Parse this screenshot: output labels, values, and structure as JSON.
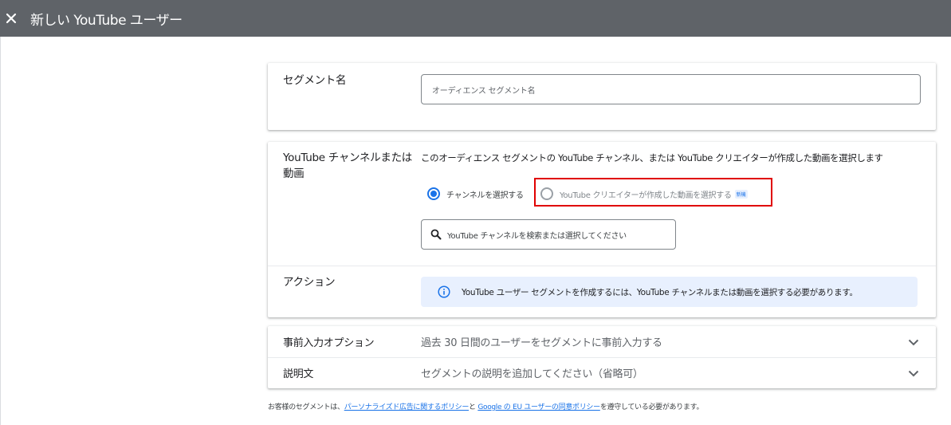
{
  "header": {
    "close_icon": "close-icon",
    "title": "新しい YouTube ユーザー"
  },
  "segment_name": {
    "label": "セグメント名",
    "placeholder": "オーディエンス セグメント名"
  },
  "channel_or_video": {
    "label_line1": "YouTube チャンネルまたは",
    "label_line2": "動画",
    "description": "このオーディエンス セグメントの YouTube チャンネル、または YouTube クリエイターが作成した動画を選択します",
    "options": [
      {
        "label": "チャンネルを選択する",
        "selected": true
      },
      {
        "label": "YouTube クリエイターが作成した動画を選択する",
        "selected": false,
        "badge": "新機"
      }
    ],
    "search_placeholder": "YouTube チャンネルを検索または選択してください",
    "search_icon": "search-icon"
  },
  "action": {
    "label": "アクション",
    "info_icon": "info-icon",
    "info_text": "YouTube ユーザー セグメントを作成するには、YouTube チャンネルまたは動画を選択する必要があります。"
  },
  "prefill": {
    "label": "事前入力オプション",
    "value": "過去 30 日間のユーザーをセグメントに事前入力する"
  },
  "description_row": {
    "label": "説明文",
    "value": "セグメントの説明を追加してください（省略可）"
  },
  "footer": {
    "prefix": "お客様のセグメントは、",
    "link1": "パーソナライズド広告に関するポリシー",
    "mid": "と",
    "link2": "Google の EU ユーザーの同意ポリシー",
    "suffix": "を遵守している必要があります。"
  },
  "colors": {
    "header_bg": "#5f6368",
    "accent": "#1a73e8",
    "highlight_border": "#e00000",
    "info_bg": "#e8f0fe"
  }
}
